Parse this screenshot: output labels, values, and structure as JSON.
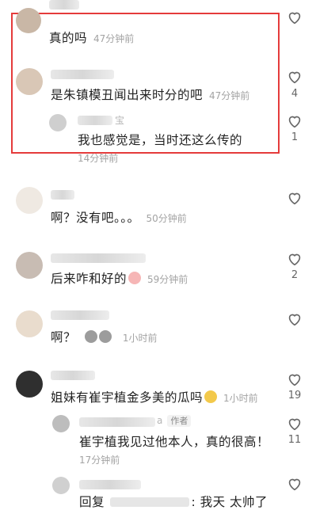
{
  "comments": [
    {
      "text": "真的吗",
      "time": "47分钟前",
      "likes": ""
    },
    {
      "text": "是朱镇模丑闻出来时分的吧",
      "time": "47分钟前",
      "likes": "4"
    },
    {
      "name_suffix": "宝",
      "text": "我也感觉是，当时还这么传的",
      "time": "14分钟前",
      "likes": "1"
    },
    {
      "text": "啊？没有吧。。。",
      "time": "50分钟前",
      "likes": ""
    },
    {
      "text": "后来咋和好的",
      "time": "59分钟前",
      "likes": "2"
    },
    {
      "text": "啊？",
      "time": "1小时前",
      "likes": ""
    },
    {
      "text": "姐妹有崔宇植金多美的瓜吗",
      "time": "1小时前",
      "likes": "19"
    },
    {
      "name_suffix": "a",
      "author_tag": "作者",
      "text": "崔宇植我见过他本人，真的很高！",
      "time": "17分钟前",
      "likes": "11"
    },
    {
      "text_prefix": "回复",
      "text_suffix": ": 我天 太帅了",
      "likes": ""
    }
  ],
  "icons": {
    "like": "heart-outline-icon",
    "emoji_pig": "pig-face-emoji",
    "emoji_sweat": "sweat-smile-emoji",
    "emoji_stone": "stone-face-emoji"
  },
  "colors": {
    "highlight_box": "#e53b3b",
    "secondary_text": "#a3a3a3"
  }
}
